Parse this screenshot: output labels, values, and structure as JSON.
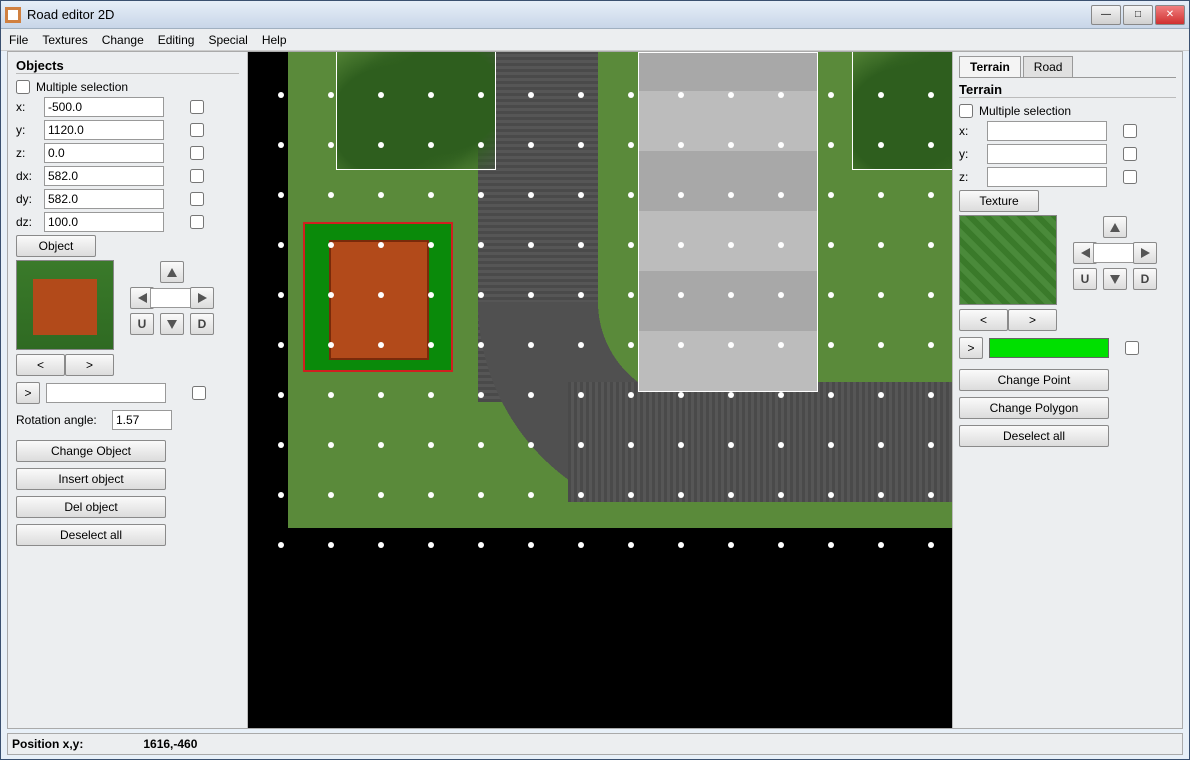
{
  "window": {
    "title": "Road editor 2D"
  },
  "menu": {
    "file": "File",
    "textures": "Textures",
    "change": "Change",
    "editing": "Editing",
    "special": "Special",
    "help": "Help"
  },
  "objects_panel": {
    "title": "Objects",
    "multiple_selection": "Multiple selection",
    "fields": {
      "x_label": "x:",
      "x": "-500.0",
      "y_label": "y:",
      "y": "1120.0",
      "z_label": "z:",
      "z": "0.0",
      "dx_label": "dx:",
      "dx": "582.0",
      "dy_label": "dy:",
      "dy": "582.0",
      "dz_label": "dz:",
      "dz": "100.0"
    },
    "object_btn": "Object",
    "nav": {
      "prev": "<",
      "next": ">",
      "u": "U",
      "d": "D",
      "gt": ">"
    },
    "rotation_label": "Rotation angle:",
    "rotation": "1.57",
    "change_object": "Change Object",
    "insert_object": "Insert object",
    "del_object": "Del object",
    "deselect_all": "Deselect all"
  },
  "right_panel": {
    "tabs": {
      "terrain": "Terrain",
      "road": "Road"
    },
    "title": "Terrain",
    "multiple_selection": "Multiple selection",
    "x_label": "x:",
    "y_label": "y:",
    "z_label": "z:",
    "x": "",
    "y": "",
    "z": "",
    "texture": "Texture",
    "prev": "<",
    "next": ">",
    "u": "U",
    "d": "D",
    "gt": ">",
    "change_point": "Change Point",
    "change_polygon": "Change Polygon",
    "deselect_all": "Deselect all"
  },
  "status": {
    "label": "Position x,y:",
    "value": "1616,-460"
  },
  "winbtns": {
    "min": "—",
    "max": "□",
    "close": "✕"
  }
}
